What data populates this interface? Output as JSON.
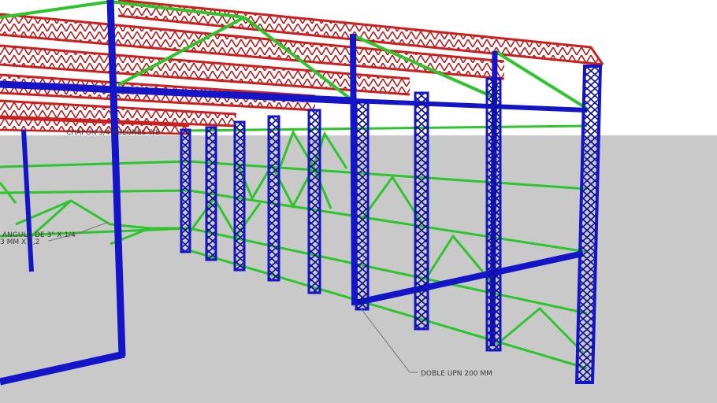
{
  "colors": {
    "sky": "#ffffff",
    "ground": "#c9c9c9",
    "roof_truss": "#cc1f1f",
    "column": "#1414c8",
    "bracing": "#2ec42e",
    "leader": "#777777"
  },
  "labels": {
    "chapon": "CHAPON 3/4  BULONES 7/8",
    "angulo": "ANGULO DE 3\" X 1/4",
    "mm": "3 MM X 3,2",
    "upn": "DOBLE UPN 200 MM"
  }
}
